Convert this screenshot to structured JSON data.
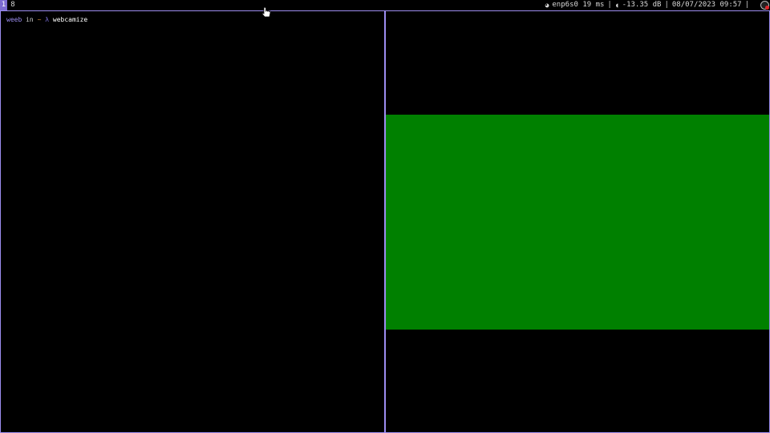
{
  "workspaces": [
    {
      "label": "1",
      "active": true
    },
    {
      "label": "8",
      "active": false
    }
  ],
  "status_bar": {
    "network_icon": "network-icon",
    "network": "enp6s0 19 ms",
    "volume_icon": "volume-icon",
    "volume": "-13.35 dB",
    "datetime": "08/07/2023 09:57",
    "separator": "|",
    "tray_icon": "app-tray-icon"
  },
  "terminal": {
    "user": "weeb",
    "in": "in",
    "directory": "~",
    "lambda": "λ",
    "command": "webcamize"
  },
  "webcam_window": {
    "frame_color": "#008000"
  },
  "colors": {
    "accent": "#9c8df0",
    "workspace_active_bg": "#7c6bd0",
    "background": "#000000"
  }
}
